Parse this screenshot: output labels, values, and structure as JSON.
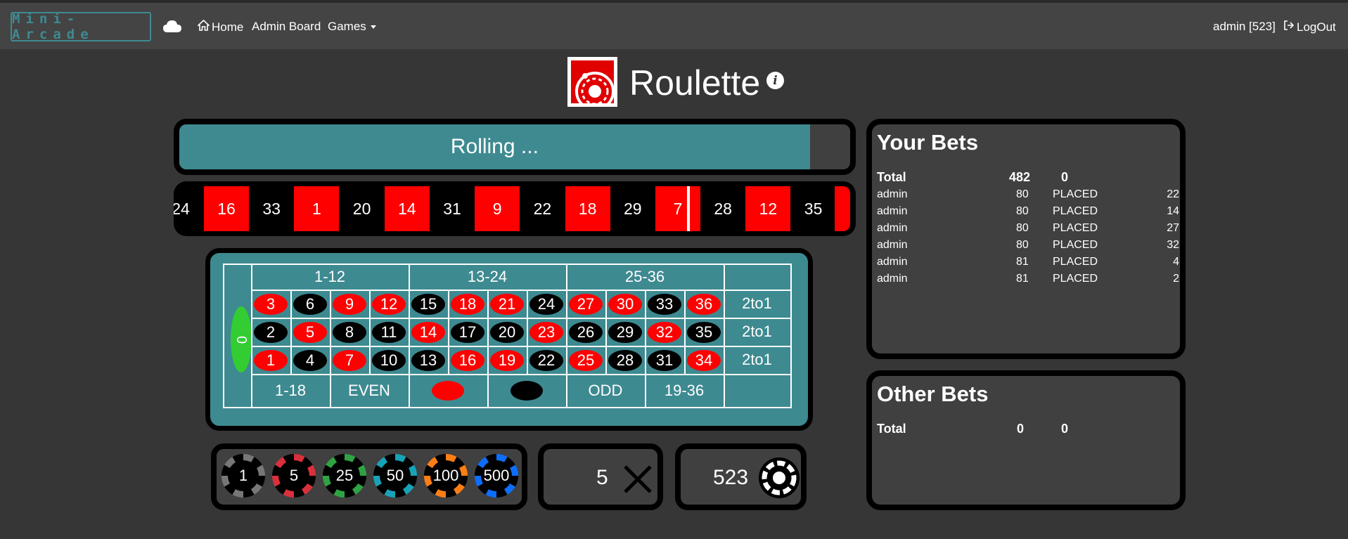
{
  "nav": {
    "brand": "Mini-Arcade",
    "home": "Home",
    "admin_board": "Admin Board",
    "games": "Games",
    "user": "admin [523]",
    "logout": "LogOut"
  },
  "title": "Roulette",
  "info_glyph": "i",
  "status": {
    "text": "Rolling ...",
    "progress": 0.94
  },
  "strip": {
    "partial_left": "24",
    "cells": [
      {
        "n": "16",
        "c": "red"
      },
      {
        "n": "33",
        "c": "black"
      },
      {
        "n": "1",
        "c": "red"
      },
      {
        "n": "20",
        "c": "black"
      },
      {
        "n": "14",
        "c": "red"
      },
      {
        "n": "31",
        "c": "black"
      },
      {
        "n": "9",
        "c": "red"
      },
      {
        "n": "22",
        "c": "black"
      },
      {
        "n": "18",
        "c": "red"
      },
      {
        "n": "29",
        "c": "black"
      },
      {
        "n": "7",
        "c": "red"
      },
      {
        "n": "28",
        "c": "black"
      },
      {
        "n": "12",
        "c": "red"
      },
      {
        "n": "35",
        "c": "black"
      }
    ]
  },
  "table": {
    "zero": "0",
    "dozens": [
      "1-12",
      "13-24",
      "25-36"
    ],
    "rows": [
      [
        {
          "n": "3",
          "c": "red"
        },
        {
          "n": "6",
          "c": "black"
        },
        {
          "n": "9",
          "c": "red"
        },
        {
          "n": "12",
          "c": "red"
        },
        {
          "n": "15",
          "c": "black"
        },
        {
          "n": "18",
          "c": "red"
        },
        {
          "n": "21",
          "c": "red"
        },
        {
          "n": "24",
          "c": "black"
        },
        {
          "n": "27",
          "c": "red"
        },
        {
          "n": "30",
          "c": "red"
        },
        {
          "n": "33",
          "c": "black"
        },
        {
          "n": "36",
          "c": "red"
        }
      ],
      [
        {
          "n": "2",
          "c": "black"
        },
        {
          "n": "5",
          "c": "red"
        },
        {
          "n": "8",
          "c": "black"
        },
        {
          "n": "11",
          "c": "black"
        },
        {
          "n": "14",
          "c": "red"
        },
        {
          "n": "17",
          "c": "black"
        },
        {
          "n": "20",
          "c": "black"
        },
        {
          "n": "23",
          "c": "red"
        },
        {
          "n": "26",
          "c": "black"
        },
        {
          "n": "29",
          "c": "black"
        },
        {
          "n": "32",
          "c": "red"
        },
        {
          "n": "35",
          "c": "black"
        }
      ],
      [
        {
          "n": "1",
          "c": "red"
        },
        {
          "n": "4",
          "c": "black"
        },
        {
          "n": "7",
          "c": "red"
        },
        {
          "n": "10",
          "c": "black"
        },
        {
          "n": "13",
          "c": "black"
        },
        {
          "n": "16",
          "c": "red"
        },
        {
          "n": "19",
          "c": "red"
        },
        {
          "n": "22",
          "c": "black"
        },
        {
          "n": "25",
          "c": "red"
        },
        {
          "n": "28",
          "c": "black"
        },
        {
          "n": "31",
          "c": "black"
        },
        {
          "n": "34",
          "c": "red"
        }
      ]
    ],
    "columns": [
      "2to1",
      "2to1",
      "2to1"
    ],
    "outside": [
      "1-18",
      "EVEN",
      "",
      "",
      "ODD",
      "19-36"
    ]
  },
  "chips": [
    {
      "value": "1",
      "color": "#777777"
    },
    {
      "value": "5",
      "color": "#d9303c"
    },
    {
      "value": "25",
      "color": "#2fa344"
    },
    {
      "value": "50",
      "color": "#18a2b8"
    },
    {
      "value": "100",
      "color": "#fd7e14"
    },
    {
      "value": "500",
      "color": "#0d6efd"
    }
  ],
  "multiplier": "5",
  "credit": "523",
  "your_bets": {
    "title": "Your Bets",
    "total": {
      "label": "Total",
      "amount": "482",
      "win": "0"
    },
    "rows": [
      {
        "user": "admin",
        "amount": "80",
        "status": "PLACED",
        "number": "22"
      },
      {
        "user": "admin",
        "amount": "80",
        "status": "PLACED",
        "number": "14"
      },
      {
        "user": "admin",
        "amount": "80",
        "status": "PLACED",
        "number": "27"
      },
      {
        "user": "admin",
        "amount": "80",
        "status": "PLACED",
        "number": "32"
      },
      {
        "user": "admin",
        "amount": "81",
        "status": "PLACED",
        "number": "4"
      },
      {
        "user": "admin",
        "amount": "81",
        "status": "PLACED",
        "number": "2"
      }
    ]
  },
  "other_bets": {
    "title": "Other Bets",
    "total": {
      "label": "Total",
      "amount": "0",
      "win": "0"
    }
  }
}
